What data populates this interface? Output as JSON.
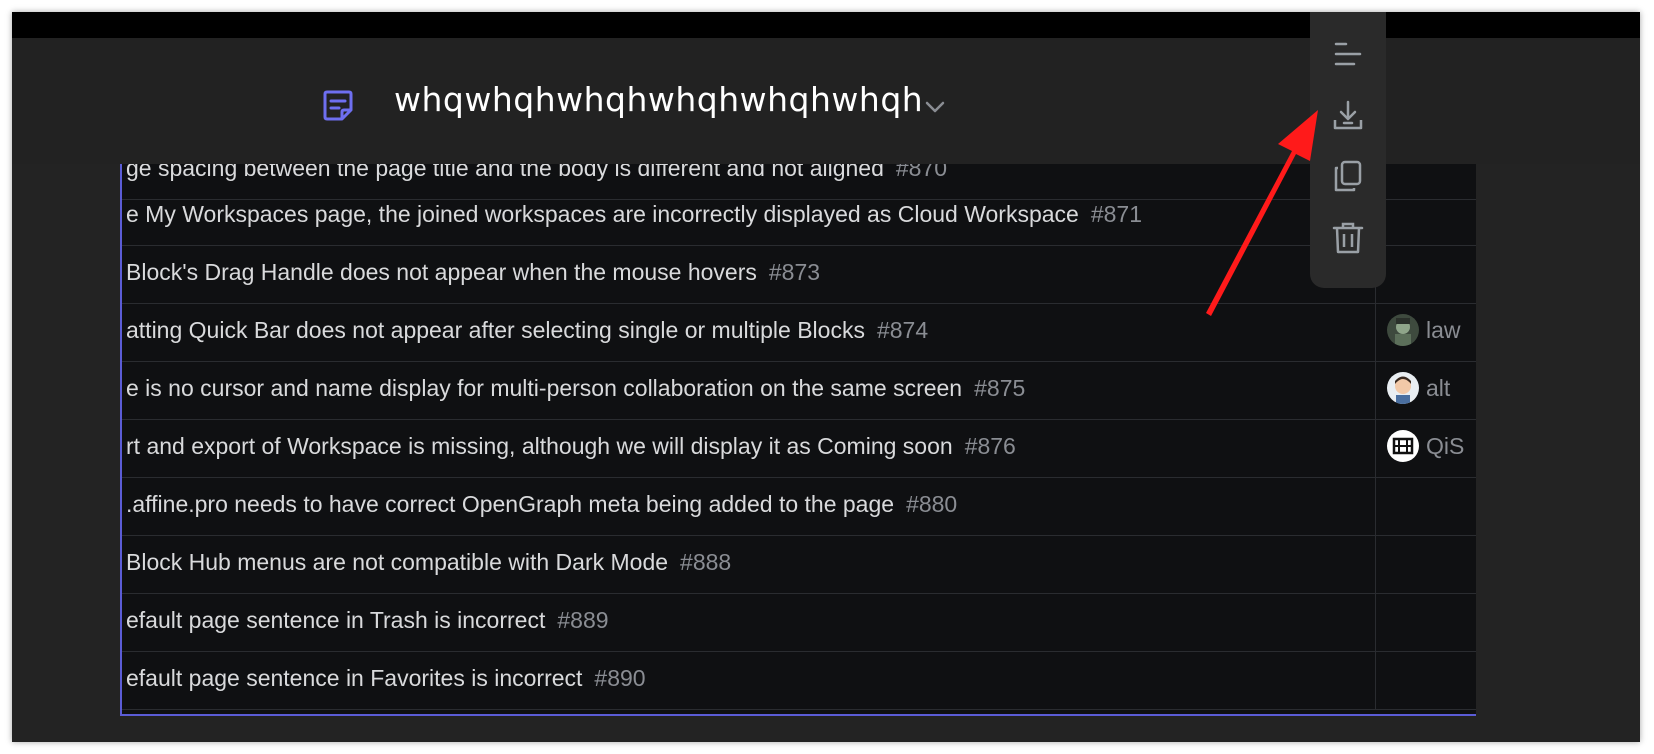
{
  "document": {
    "title": "whqwhqhwhqhwhqhwhqhwhqh",
    "icon": "page-icon",
    "accent_color": "#6e6ff0"
  },
  "toolbar": {
    "items": [
      {
        "name": "align-left-icon"
      },
      {
        "name": "download-icon"
      },
      {
        "name": "copy-icon"
      },
      {
        "name": "trash-icon"
      }
    ]
  },
  "table": {
    "rows": [
      {
        "title": "ge spacing between the page title and the body is different and not aligned",
        "number": "#870",
        "assignee": ""
      },
      {
        "title": "e My Workspaces page, the joined workspaces are incorrectly displayed as Cloud Workspace",
        "number": "#871",
        "assignee": ""
      },
      {
        "title": " Block's Drag Handle does not appear when the mouse hovers",
        "number": "#873",
        "assignee": ""
      },
      {
        "title": "atting Quick Bar does not appear after selecting single or multiple Blocks",
        "number": "#874",
        "assignee": "law"
      },
      {
        "title": "e is no cursor and name display for multi-person collaboration on the same screen",
        "number": "#875",
        "assignee": "alt"
      },
      {
        "title": "rt and export of Workspace is missing, although we will display it as Coming soon",
        "number": "#876",
        "assignee": "QiS"
      },
      {
        "title": ".affine.pro needs to have correct OpenGraph meta being added to the page",
        "number": "#880",
        "assignee": ""
      },
      {
        "title": " Block Hub menus are not compatible with Dark Mode",
        "number": "#888",
        "assignee": ""
      },
      {
        "title": "efault page sentence in Trash is incorrect",
        "number": "#889",
        "assignee": ""
      },
      {
        "title": "efault page sentence in Favorites is incorrect",
        "number": "#890",
        "assignee": ""
      }
    ]
  },
  "annotation": {
    "color": "#ff1a1a"
  }
}
